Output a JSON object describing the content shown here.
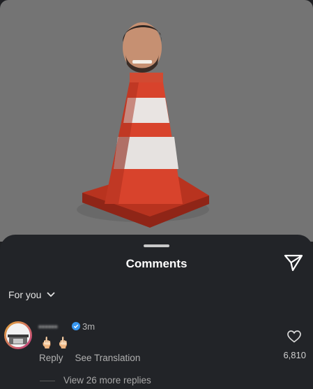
{
  "sheet": {
    "title": "Comments",
    "filter_label": "For you",
    "filter_icon": "chevron-down-icon",
    "share_icon": "paper-plane-icon"
  },
  "comment": {
    "avatar_icon": "avatar",
    "verified_icon": "verified-badge-icon",
    "time": "3m",
    "text": "🖕🏻🖕🏻",
    "reply_label": "Reply",
    "translate_label": "See Translation",
    "like_icon": "heart-icon",
    "like_count": "6,810",
    "view_replies": "View 26 more replies"
  },
  "colors": {
    "sheet_bg": "#222428",
    "media_bg": "#747474",
    "verified": "#3897f0",
    "cone": "#d8432c"
  }
}
